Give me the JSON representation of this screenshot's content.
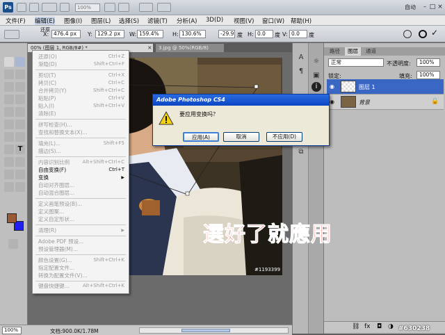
{
  "app": {
    "logo": "Ps",
    "zoom": "100%",
    "workspace": "自动",
    "window_controls": [
      "–",
      "□",
      "×"
    ]
  },
  "menubar": [
    "文件(F)",
    "编辑(E)",
    "图像(I)",
    "图层(L)",
    "选择(S)",
    "滤镜(T)",
    "分析(A)",
    "3D(D)",
    "视图(V)",
    "窗口(W)",
    "帮助(H)"
  ],
  "options": {
    "x_label": "X:",
    "x_value": "476.4 px",
    "y_label": "Y:",
    "y_value": "129.2 px",
    "w_label": "W:",
    "w_value": "159.4%",
    "h_label": "H:",
    "h_value": "130.6%",
    "angle_value": "-29.9",
    "angle_unit": "度",
    "hskew_label": "H:",
    "hskew_value": "0.0",
    "hskew_unit": "度",
    "vskew_label": "V:",
    "vskew_value": "0.0",
    "vskew_unit": "度",
    "partial_label": "还原"
  },
  "documents": {
    "tab1": "00% (图层 1, RGB/8#) *",
    "tab2": "3.jpg @ 50%(RGB/8)",
    "close": "×"
  },
  "status": {
    "zoom": "100%",
    "info": "文档:900.0K/1.78M"
  },
  "watermark": "#1193399",
  "corner_id": "#630238",
  "overlay_text": "選好了就應用",
  "edit_menu": {
    "undo": {
      "label": "还原(O)",
      "sc": "Ctrl+Z"
    },
    "step_fwd": {
      "label": "渐隐(D)",
      "sc": "Shift+Ctrl+F"
    },
    "cut": {
      "label": "剪切(T)",
      "sc": "Ctrl+X"
    },
    "copy": {
      "label": "拷贝(C)",
      "sc": "Ctrl+C"
    },
    "copy_merged": {
      "label": "合并拷贝(Y)",
      "sc": "Shift+Ctrl+C"
    },
    "paste": {
      "label": "粘贴(P)",
      "sc": "Ctrl+V"
    },
    "paste_into": {
      "label": "贴入(I)",
      "sc": "Shift+Ctrl+V"
    },
    "clear": {
      "label": "清除(E)",
      "sc": ""
    },
    "spell": {
      "label": "拼写检查(H)...",
      "sc": ""
    },
    "find": {
      "label": "查找和替换文本(X)...",
      "sc": ""
    },
    "fill": {
      "label": "填充(L)...",
      "sc": "Shift+F5"
    },
    "stroke": {
      "label": "描边(S)...",
      "sc": ""
    },
    "content_scale": {
      "label": "内容识别比例",
      "sc": "Alt+Shift+Ctrl+C"
    },
    "free_transform": {
      "label": "自由变换(F)",
      "sc": "Ctrl+T"
    },
    "transform": {
      "label": "变换",
      "sc": "▶"
    },
    "auto_align": {
      "label": "自动对齐图层...",
      "sc": ""
    },
    "auto_blend": {
      "label": "自动混合图层...",
      "sc": ""
    },
    "define_brush": {
      "label": "定义画笔预设(B)...",
      "sc": ""
    },
    "define_pattern": {
      "label": "定义图案...",
      "sc": ""
    },
    "define_shape": {
      "label": "定义自定形状...",
      "sc": ""
    },
    "purge": {
      "label": "清理(R)",
      "sc": "▶"
    },
    "pdf_presets": {
      "label": "Adobe PDF 预设...",
      "sc": ""
    },
    "preset_manager": {
      "label": "预设管理器(M)...",
      "sc": ""
    },
    "color_settings": {
      "label": "颜色设置(G)...",
      "sc": "Shift+Ctrl+K"
    },
    "assign_profile": {
      "label": "指定配置文件...",
      "sc": ""
    },
    "convert_profile": {
      "label": "转换为配置文件(V)...",
      "sc": ""
    },
    "shortcuts": {
      "label": "键盘快捷键...",
      "sc": "Alt+Shift+Ctrl+K"
    },
    "menus": {
      "label": "菜单(U)...",
      "sc": "Alt+Shift+Ctrl+M"
    },
    "preferences": {
      "label": "首选项(N)",
      "sc": "▶"
    }
  },
  "dialog": {
    "title": "Adobe Photoshop CS4",
    "message": "要应用变换吗？",
    "apply": "应用(A)",
    "cancel": "取消",
    "dont_apply": "不应用(D)"
  },
  "layers": {
    "tabs": [
      "路径",
      "图层",
      "通道"
    ],
    "blend_mode": "正常",
    "opacity_label": "不透明度:",
    "opacity": "100%",
    "fill_label": "填充:",
    "fill": "100%",
    "lock_label": "锁定:",
    "items": [
      {
        "name": "图层 1",
        "selected": true
      },
      {
        "name": "背景",
        "selected": false
      }
    ]
  },
  "colors": {
    "foreground": "#9b5a36",
    "background": "#1f1ff0",
    "overlay": "#f20d0d",
    "selection": "#3a66c4"
  }
}
